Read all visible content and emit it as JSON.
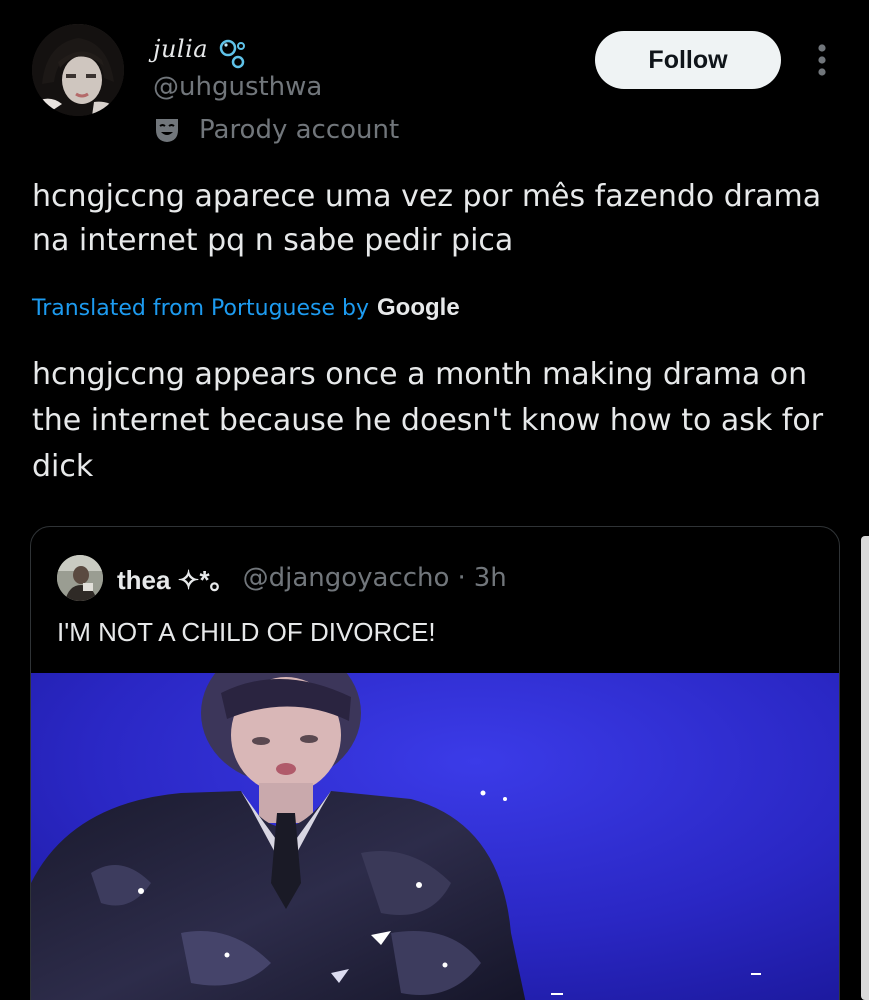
{
  "author": {
    "display_name": "julia",
    "name_emoji": "bubbles-emoji",
    "handle": "@uhgusthwa",
    "parody_label": "Parody account",
    "parody_icon": "theater-mask-icon"
  },
  "actions": {
    "follow_label": "Follow",
    "more_icon": "more-vertical-icon"
  },
  "tweet": {
    "text": "hcngjccng aparece uma vez por mês fazendo drama na internet pq n sabe pedir pica",
    "translated_label": "Translated from Portuguese by",
    "translation_provider": "Google",
    "translated_text": "hcngjccng appears once a month making drama on the internet because he doesn't know how to ask for dick"
  },
  "quote": {
    "display_name": "thea ✧*｡",
    "handle": "@djangoyaccho",
    "separator": "·",
    "time": "3h",
    "text": "I'M NOT A CHILD OF DIVORCE!"
  },
  "colors": {
    "background": "#000000",
    "text_primary": "#e7e9ea",
    "text_secondary": "#71767b",
    "link": "#1d9bf0",
    "follow_bg": "#eff3f4",
    "media_blue": "#2f2fd0"
  }
}
